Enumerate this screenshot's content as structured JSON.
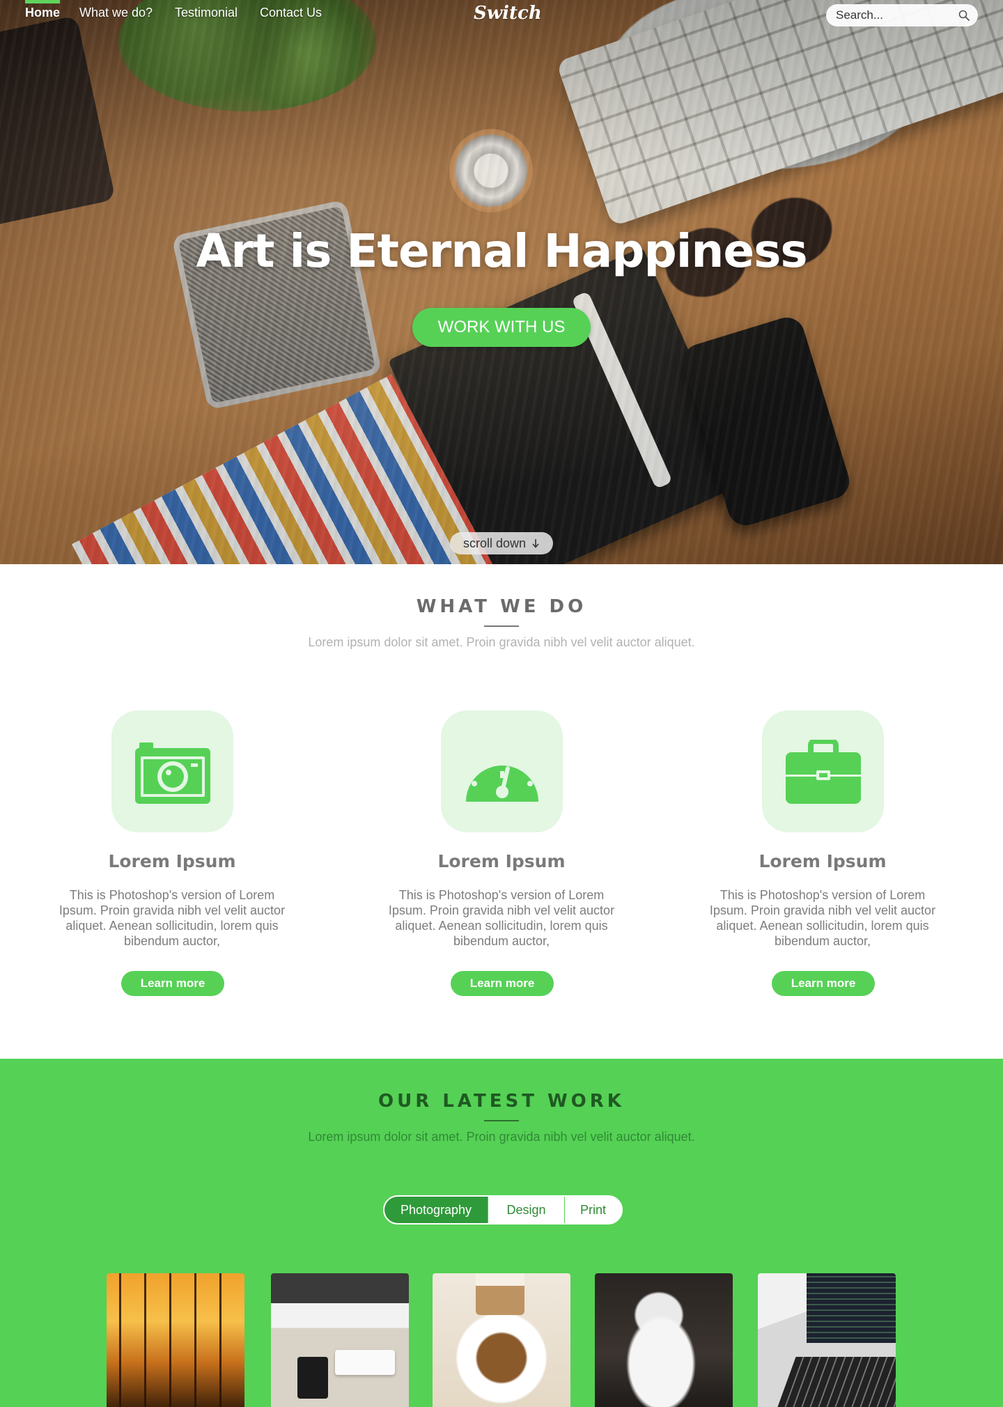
{
  "nav": {
    "logo": "Switch",
    "items": [
      {
        "label": "Home",
        "active": true
      },
      {
        "label": "What we do?",
        "active": false
      },
      {
        "label": "Testimonial",
        "active": false
      },
      {
        "label": "Contact Us",
        "active": false
      }
    ],
    "search_placeholder": "Search..."
  },
  "hero": {
    "title": "Art is Eternal Happiness",
    "cta_label": "WORK WITH US",
    "scroll_label": "scroll down"
  },
  "what_we_do": {
    "title": "WHAT WE DO",
    "subtitle": "Lorem ipsum dolor sit amet. Proin gravida nibh vel velit auctor aliquet.",
    "features": [
      {
        "icon": "camera-icon",
        "title": "Lorem Ipsum",
        "text": "This is Photoshop's version  of Lorem Ipsum. Proin gravida nibh vel velit auctor aliquet. Aenean sollicitudin, lorem quis bibendum auctor,",
        "button": "Learn more"
      },
      {
        "icon": "speedometer-icon",
        "title": "Lorem Ipsum",
        "text": "This is Photoshop's version  of Lorem Ipsum. Proin gravida nibh vel velit auctor aliquet. Aenean sollicitudin, lorem quis bibendum auctor,",
        "button": "Learn more"
      },
      {
        "icon": "briefcase-icon",
        "title": "Lorem Ipsum",
        "text": "This is Photoshop's version  of Lorem Ipsum. Proin gravida nibh vel velit auctor aliquet. Aenean sollicitudin, lorem quis bibendum auctor,",
        "button": "Learn more"
      }
    ]
  },
  "latest_work": {
    "title": "OUR LATEST WORK",
    "subtitle": "Lorem ipsum dolor sit amet. Proin gravida nibh vel velit auctor aliquet.",
    "tabs": [
      {
        "label": "Photography",
        "active": true
      },
      {
        "label": "Design",
        "active": false
      },
      {
        "label": "Print",
        "active": false
      }
    ],
    "thumbnails": [
      "sunset-trees",
      "desk-setup",
      "coffee-cake",
      "kitten",
      "laptop-code"
    ]
  },
  "colors": {
    "accent": "#55d155",
    "accent_dark": "#2f9a3a",
    "icon_bg": "#e3f7e3",
    "text_gray": "#7a7a7a"
  }
}
